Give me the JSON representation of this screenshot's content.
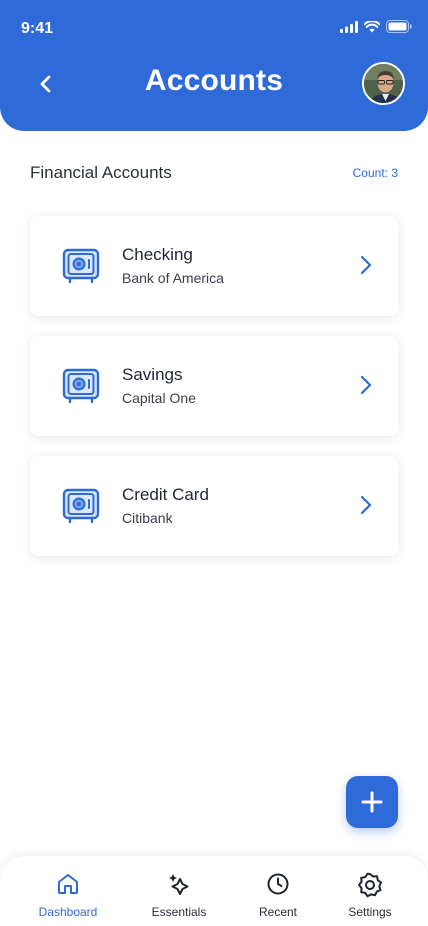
{
  "status_bar": {
    "time": "9:41"
  },
  "header": {
    "title": "Accounts",
    "back_icon": "chevron-left-icon",
    "avatar": "user-avatar"
  },
  "section": {
    "title": "Financial Accounts",
    "count": "Count: 3"
  },
  "accounts": [
    {
      "name": "Checking",
      "bank": "Bank of America",
      "icon": "safe-icon"
    },
    {
      "name": "Savings",
      "bank": "Capital One",
      "icon": "safe-icon"
    },
    {
      "name": "Credit Card",
      "bank": "Citibank",
      "icon": "safe-icon"
    }
  ],
  "fab": {
    "icon": "plus-icon"
  },
  "tabs": [
    {
      "label": "Dashboard",
      "icon": "home-icon",
      "active": true
    },
    {
      "label": "Essentials",
      "icon": "sparkle-icon",
      "active": false
    },
    {
      "label": "Recent",
      "icon": "clock-icon",
      "active": false
    },
    {
      "label": "Settings",
      "icon": "gear-icon",
      "active": false
    }
  ],
  "colors": {
    "primary": "#2f6bd8",
    "text": "#1f2433",
    "background": "#ffffff"
  }
}
